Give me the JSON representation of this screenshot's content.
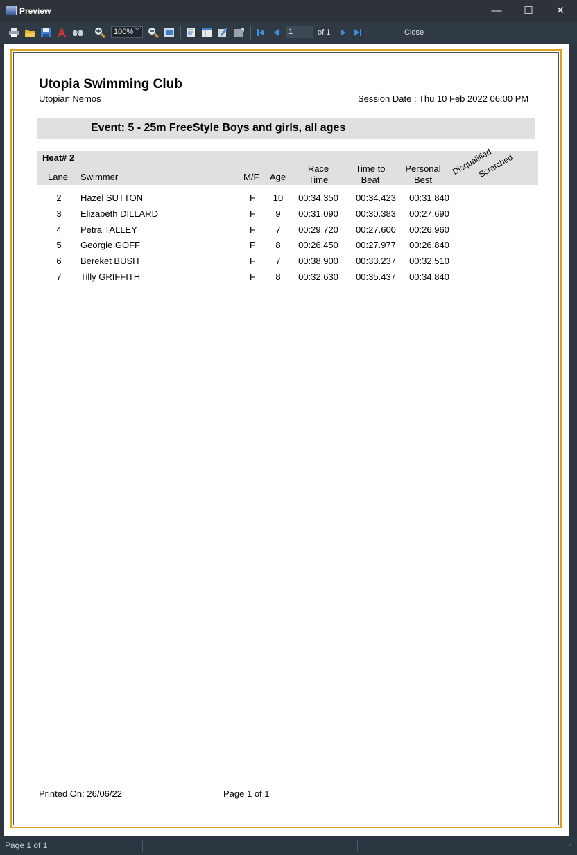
{
  "window": {
    "title": "Preview",
    "minimize": "—",
    "maximize": "☐",
    "close": "✕"
  },
  "toolbar": {
    "zoom": "100%",
    "page_input": "1",
    "of_pages": "of 1",
    "close_label": "Close",
    "icons": [
      "print-icon",
      "open-icon",
      "save-icon",
      "pdf-icon",
      "find-icon",
      "zoom-in-icon",
      "zoom-out-icon",
      "full-page-icon",
      "outline-icon",
      "thumbnails-icon",
      "edit-icon",
      "page-setup-icon",
      "first-page-icon",
      "prev-page-icon",
      "next-page-icon",
      "last-page-icon"
    ]
  },
  "report": {
    "club_name": "Utopia Swimming Club",
    "team_name": "Utopian Nemos",
    "session_date": "Session Date : Thu 10 Feb 2022 06:00 PM",
    "event": "Event: 5 - 25m FreeStyle   Boys and girls, all ages",
    "heat": "Heat#  2",
    "columns": {
      "lane": "Lane",
      "swimmer": "Swimmer",
      "mf": "M/F",
      "age": "Age",
      "race_time_1": "Race",
      "race_time_2": "Time",
      "time_to_beat_1": "Time to",
      "time_to_beat_2": "Beat",
      "personal_best_1": "Personal",
      "personal_best_2": "Best",
      "disqualified": "Disqualified",
      "scratched": "Scratched"
    },
    "rows": [
      {
        "lane": "2",
        "swimmer": "Hazel SUTTON",
        "mf": "F",
        "age": "10",
        "race": "00:34.350",
        "beat": "00:34.423",
        "pb": "00:31.840"
      },
      {
        "lane": "3",
        "swimmer": "Elizabeth DILLARD",
        "mf": "F",
        "age": "9",
        "race": "00:31.090",
        "beat": "00:30.383",
        "pb": "00:27.690"
      },
      {
        "lane": "4",
        "swimmer": "Petra TALLEY",
        "mf": "F",
        "age": "7",
        "race": "00:29.720",
        "beat": "00:27.600",
        "pb": "00:26.960"
      },
      {
        "lane": "5",
        "swimmer": "Georgie GOFF",
        "mf": "F",
        "age": "8",
        "race": "00:26.450",
        "beat": "00:27.977",
        "pb": "00:26.840"
      },
      {
        "lane": "6",
        "swimmer": "Bereket BUSH",
        "mf": "F",
        "age": "7",
        "race": "00:38.900",
        "beat": "00:33.237",
        "pb": "00:32.510"
      },
      {
        "lane": "7",
        "swimmer": "Tilly GRIFFITH",
        "mf": "F",
        "age": "8",
        "race": "00:32.630",
        "beat": "00:35.437",
        "pb": "00:34.840"
      }
    ],
    "printed_on": "Printed On: 26/06/22",
    "page_footer": "Page 1 of 1"
  },
  "statusbar": {
    "page": "Page 1 of 1"
  },
  "colors": {
    "frame": "#e0a020",
    "band": "#e0e0e0",
    "chrome": "#2f3a45"
  }
}
